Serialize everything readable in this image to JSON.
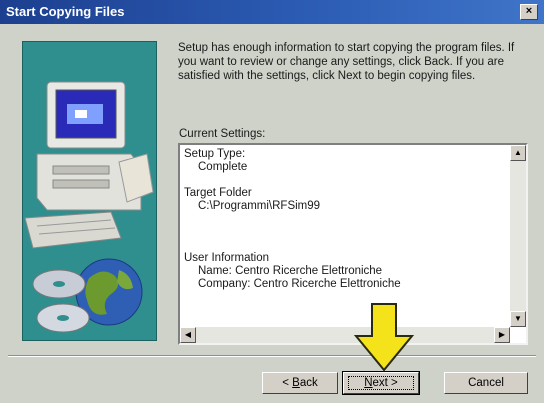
{
  "window": {
    "title": "Start Copying Files",
    "close_label": "×"
  },
  "intro": {
    "text": "Setup has enough information to start copying the program files. If you want to review or change any settings, click Back.  If you are satisfied with the settings, click Next to begin copying files."
  },
  "settings": {
    "label": "Current Settings:",
    "setup_type_label": "Setup Type:",
    "setup_type_value": "Complete",
    "target_folder_label": "Target Folder",
    "target_folder_value": "C:\\Programmi\\RFSim99",
    "user_info_label": "User Information",
    "user_name": "Name:  Centro Ricerche Elettroniche",
    "user_company": "Company:  Centro Ricerche Elettroniche"
  },
  "buttons": {
    "back_mnemonic": "B",
    "back_rest": "ack",
    "back_prefix": "< ",
    "next_mnemonic": "N",
    "next_rest": "ext >",
    "cancel": "Cancel"
  },
  "scroll_arrows": {
    "up": "▲",
    "down": "▼",
    "left": "◀",
    "right": "▶"
  },
  "colors": {
    "title_bar": "#1d3f8f",
    "artwork_bg": "#2f8f8f",
    "pointer_arrow": "#f4e21a"
  }
}
